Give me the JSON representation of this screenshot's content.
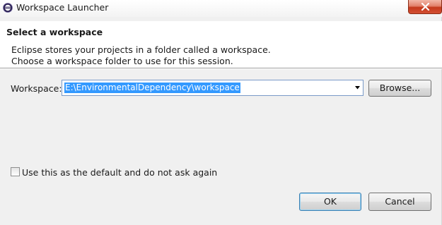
{
  "window": {
    "title": "Workspace Launcher",
    "app_icon": "eclipse-icon",
    "close_icon": "close-icon"
  },
  "header": {
    "title": "Select a workspace",
    "description_line1": "Eclipse stores your projects in a folder called a workspace.",
    "description_line2": "Choose a workspace folder to use for this session."
  },
  "workspace": {
    "label": "Workspace:",
    "value": "E:\\EnvironmentalDependency\\workspace",
    "dropdown_icon": "chevron-down-icon",
    "browse_label": "Browse..."
  },
  "default_option": {
    "label": "Use this as the default and do not ask again",
    "checked": false
  },
  "buttons": {
    "ok": "OK",
    "cancel": "Cancel"
  },
  "colors": {
    "selection": "#3399ff",
    "close_button": "#c4391d",
    "dialog_background": "#f0f0f0"
  }
}
